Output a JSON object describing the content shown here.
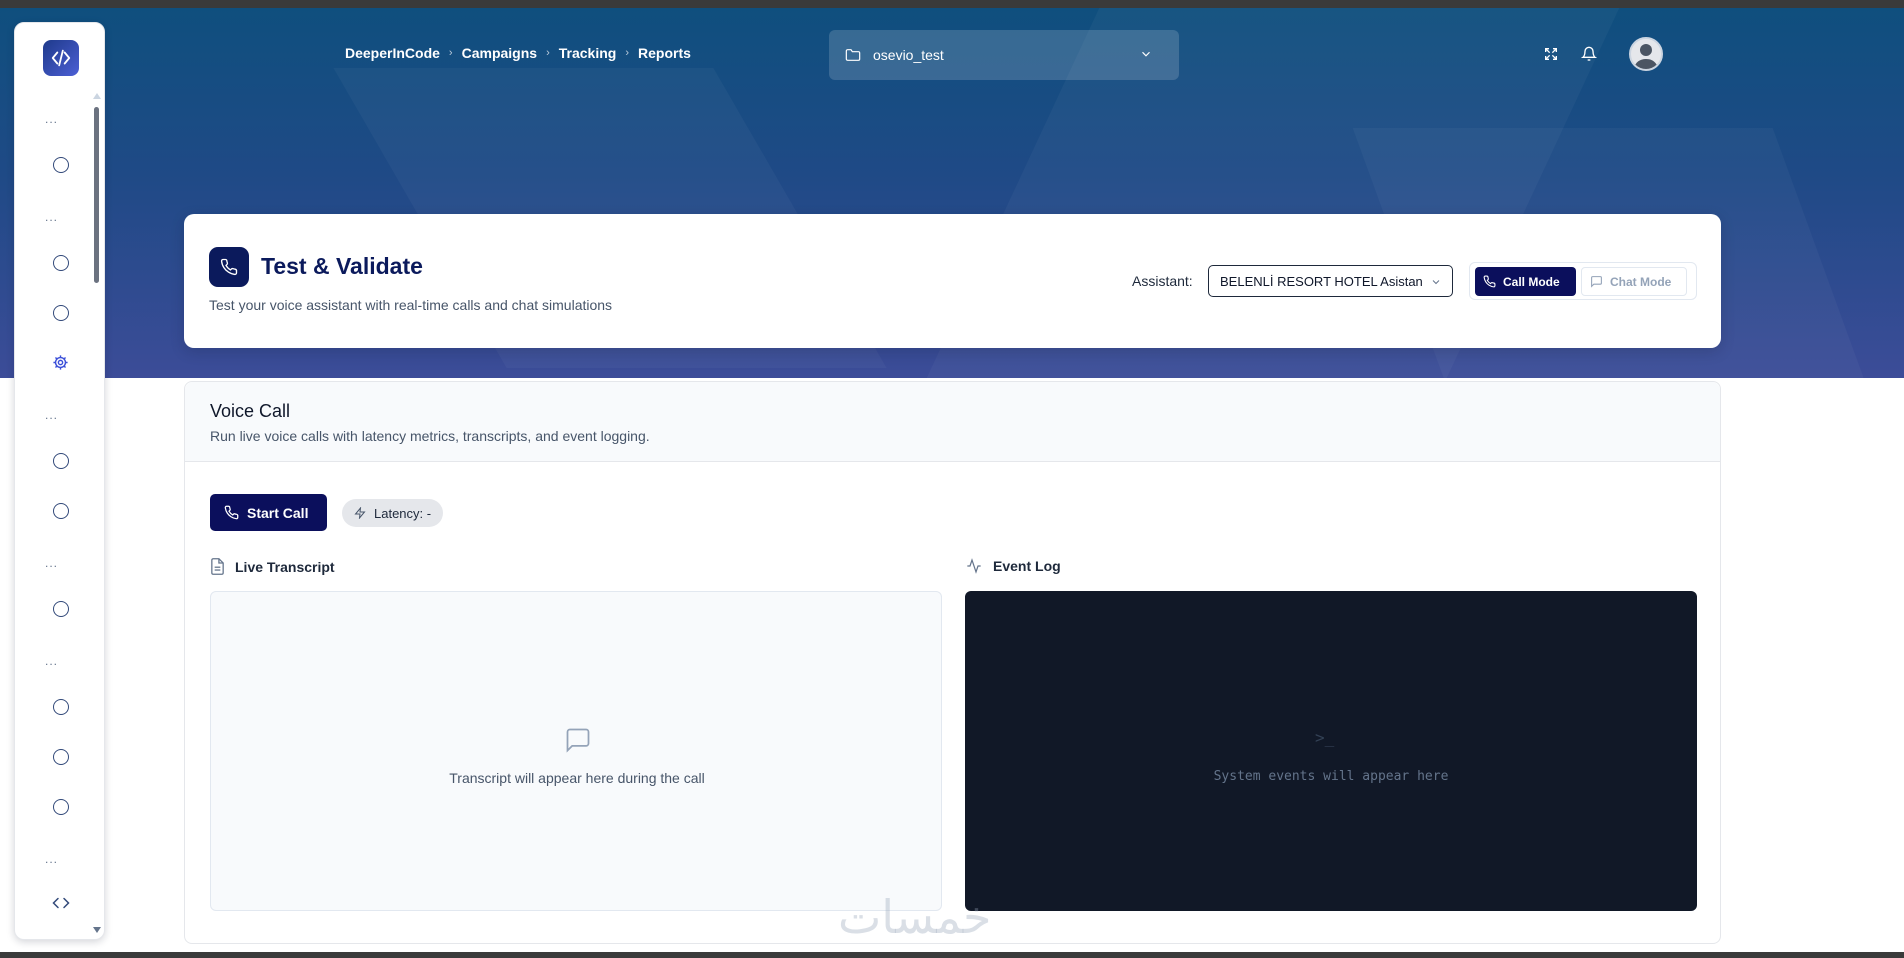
{
  "breadcrumb": [
    "DeeperInCode",
    "Campaigns",
    "Tracking",
    "Reports"
  ],
  "project_select": {
    "value": "osevio_test"
  },
  "page": {
    "title": "Test & Validate",
    "subtitle": "Test your voice assistant with real-time calls and chat simulations"
  },
  "assistant": {
    "label": "Assistant:",
    "value": "BELENLİ RESORT HOTEL Asistan"
  },
  "modes": {
    "call": "Call Mode",
    "chat": "Chat Mode"
  },
  "voice_call": {
    "title": "Voice Call",
    "description": "Run live voice calls with latency metrics, transcripts, and event logging.",
    "start_button": "Start Call",
    "latency": "Latency: -"
  },
  "transcript": {
    "title": "Live Transcript",
    "empty": "Transcript will appear here during the call"
  },
  "event_log": {
    "title": "Event Log",
    "empty": "System events will appear here",
    "prompt_icon": ">_"
  },
  "sidebar": {
    "group_marker": "...",
    "icons": [
      "logo-code-icon",
      "circle-icon",
      "gear-icon",
      "code-icon"
    ]
  },
  "watermark": "خمسات",
  "colors": {
    "primary": "#0b0f5c",
    "hero_top": "#0f4f7e",
    "hero_bottom": "#3c4c98",
    "terminal_bg": "#111827"
  }
}
